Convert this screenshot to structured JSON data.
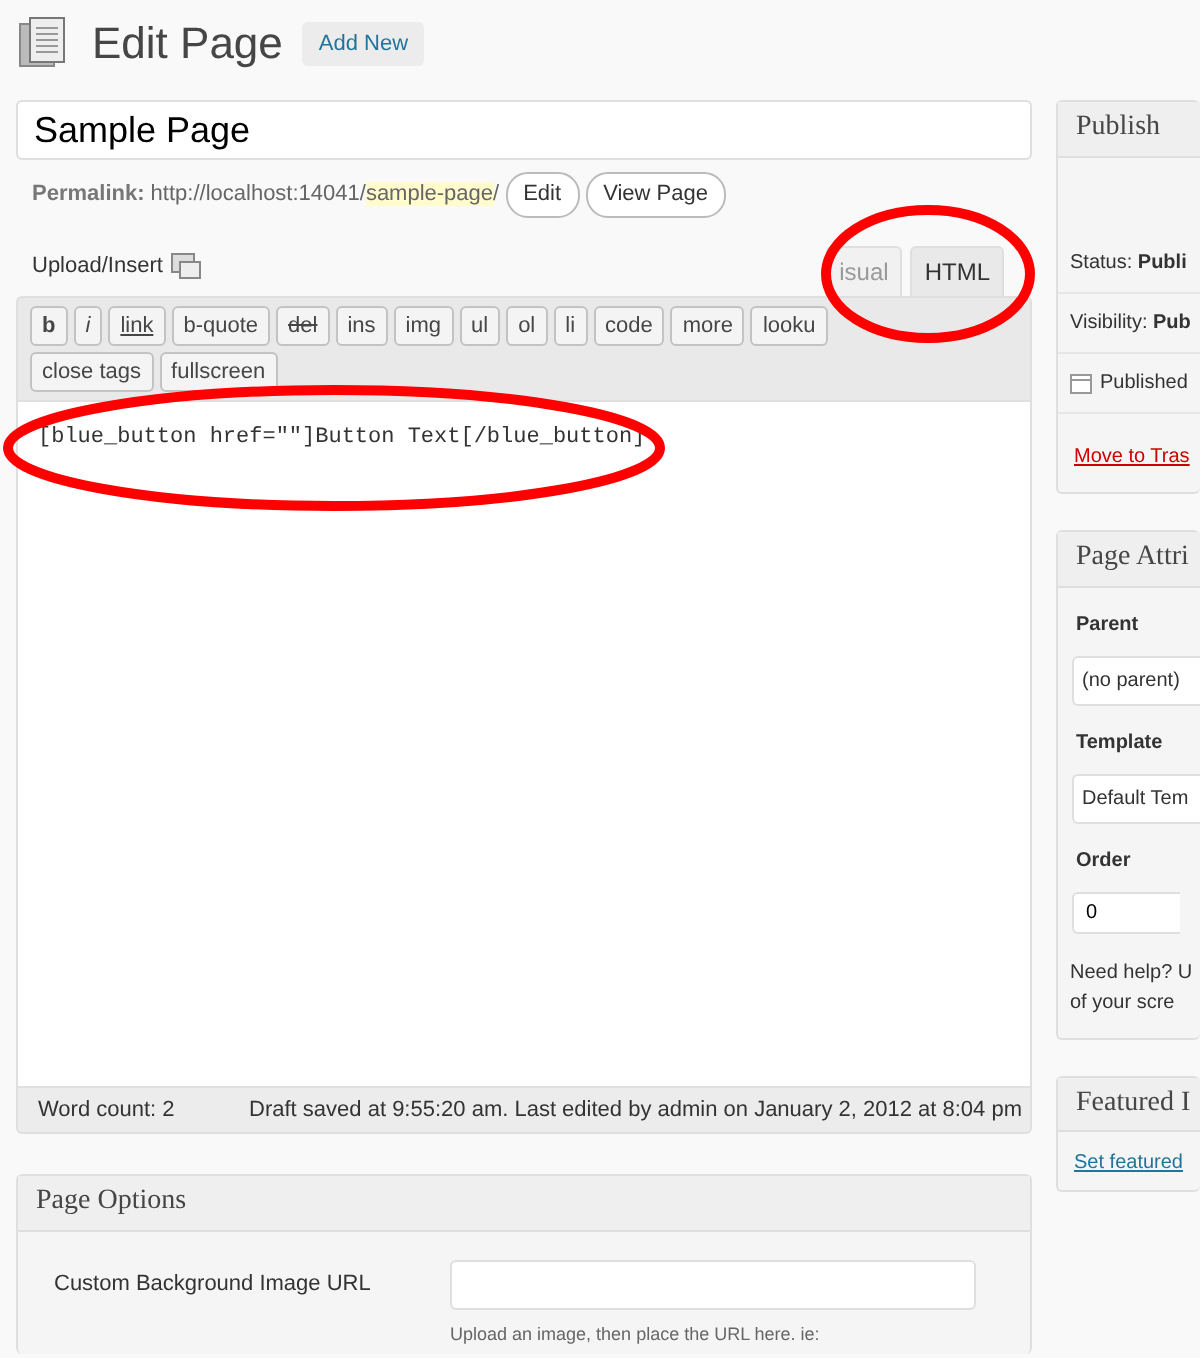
{
  "header": {
    "title": "Edit Page",
    "add_new": "Add New"
  },
  "post_title": "Sample Page",
  "permalink": {
    "label": "Permalink:",
    "prefix": "http://localhost:14041/",
    "slug": "sample-page",
    "suffix": "/",
    "buttons": [
      "Edit",
      "View Page"
    ]
  },
  "upload_insert": "Upload/Insert",
  "editor_tabs": [
    {
      "label": "isual",
      "selected": false
    },
    {
      "label": "HTML",
      "selected": true
    }
  ],
  "quicktags": [
    {
      "label": "b",
      "kind": "bold"
    },
    {
      "label": "i",
      "kind": "italic"
    },
    {
      "label": "link",
      "kind": "underline"
    },
    {
      "label": "b-quote",
      "kind": "plain"
    },
    {
      "label": "del",
      "kind": "strike"
    },
    {
      "label": "ins",
      "kind": "plain"
    },
    {
      "label": "img",
      "kind": "plain"
    },
    {
      "label": "ul",
      "kind": "plain"
    },
    {
      "label": "ol",
      "kind": "plain"
    },
    {
      "label": "li",
      "kind": "plain"
    },
    {
      "label": "code",
      "kind": "plain"
    },
    {
      "label": "more",
      "kind": "plain"
    },
    {
      "label": "looku",
      "kind": "plain"
    },
    {
      "label": "close tags",
      "kind": "plain"
    },
    {
      "label": "fullscreen",
      "kind": "plain"
    }
  ],
  "content": "[blue_button href=\"\"]Button Text[/blue_button]",
  "word_count": "Word count: 2",
  "draft_status": "Draft saved at 9:55:20 am. Last edited by admin on January 2, 2012 at 8:04 pm",
  "page_options": {
    "title": "Page Options",
    "fields": [
      {
        "label": "Custom Background Image URL",
        "hint": "Upload an image, then place the URL here. ie:"
      }
    ]
  },
  "publish": {
    "title": "Publish",
    "rows": [
      {
        "label": "Status:",
        "value": "Publi"
      },
      {
        "label": "Visibility:",
        "value": "Pub"
      },
      {
        "label": "Published",
        "value": ""
      }
    ],
    "trash": "Move to Tras"
  },
  "page_attributes": {
    "title": "Page Attri",
    "parent_label": "Parent",
    "parent": "(no parent)",
    "template_label": "Template",
    "template": "Default Tem",
    "order_label": "Order",
    "order": "0",
    "help": [
      "Need help? U",
      "of your scre"
    ]
  },
  "featured": {
    "title": "Featured I",
    "link": "Set featured"
  }
}
